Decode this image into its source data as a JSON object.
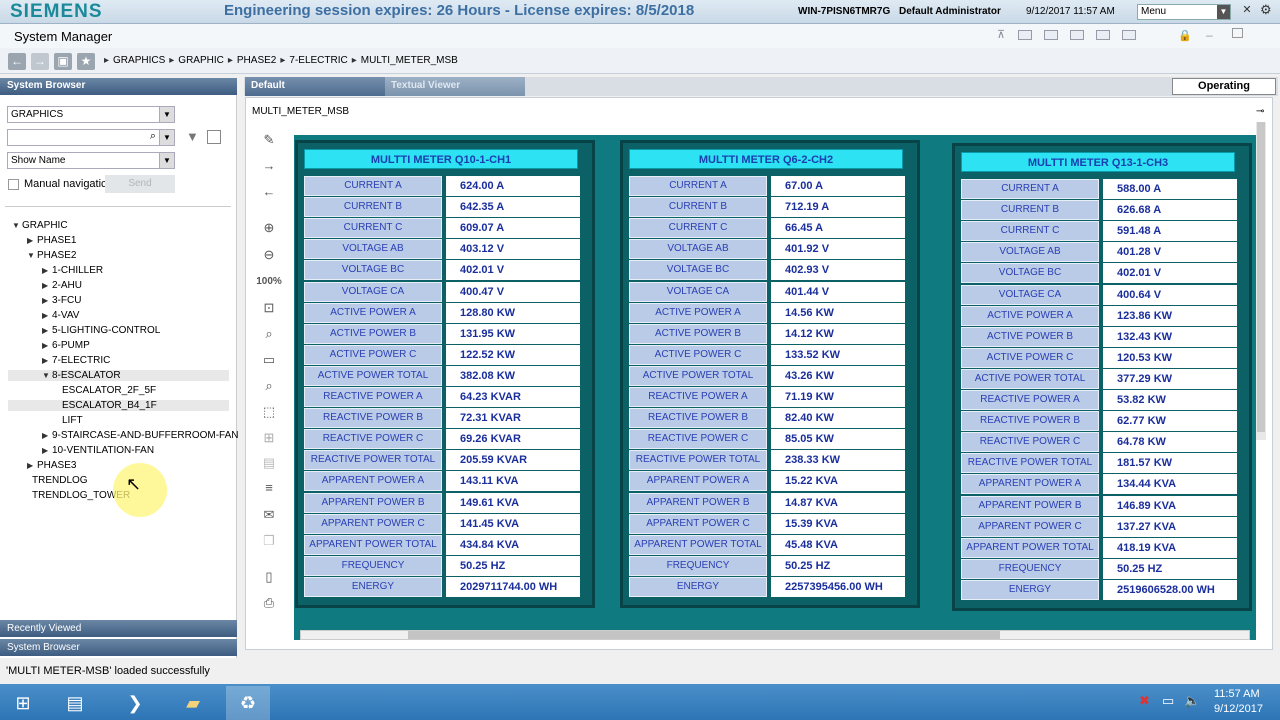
{
  "header": {
    "logo": "SIEMENS",
    "session_text": "Engineering session expires: 26 Hours - License expires: 8/5/2018",
    "hostname": "WIN-7PISN6TMR7G",
    "user": "Default Administrator",
    "datetime": "9/12/2017  11:57 AM",
    "menu_label": "Menu"
  },
  "app_title": "System Manager",
  "breadcrumb": [
    "GRAPHICS",
    "GRAPHIC",
    "PHASE2",
    "7-ELECTRIC",
    "MULTI_METER_MSB"
  ],
  "system_browser": {
    "title": "System Browser",
    "view_select": "GRAPHICS",
    "search_value": "",
    "name_select": "Show Name",
    "manual_navigation": "Manual navigatic",
    "send_label": "Send",
    "tree": [
      {
        "label": "GRAPHIC",
        "level": 0,
        "arrow": "open"
      },
      {
        "label": "PHASE1",
        "level": 1,
        "arrow": "closed"
      },
      {
        "label": "PHASE2",
        "level": 1,
        "arrow": "open"
      },
      {
        "label": "1-CHILLER",
        "level": 2,
        "arrow": "closed"
      },
      {
        "label": "2-AHU",
        "level": 2,
        "arrow": "closed"
      },
      {
        "label": "3-FCU",
        "level": 2,
        "arrow": "closed"
      },
      {
        "label": "4-VAV",
        "level": 2,
        "arrow": "closed"
      },
      {
        "label": "5-LIGHTING-CONTROL",
        "level": 2,
        "arrow": "closed"
      },
      {
        "label": "6-PUMP",
        "level": 2,
        "arrow": "closed"
      },
      {
        "label": "7-ELECTRIC",
        "level": 2,
        "arrow": "closed"
      },
      {
        "label": "8-ESCALATOR",
        "level": 2,
        "arrow": "open",
        "highlight": true
      },
      {
        "label": "ESCALATOR_2F_5F",
        "level": 3,
        "arrow": "none"
      },
      {
        "label": "ESCALATOR_B4_1F",
        "level": 3,
        "arrow": "none",
        "highlight": true
      },
      {
        "label": "LIFT",
        "level": 3,
        "arrow": "none"
      },
      {
        "label": "9-STAIRCASE-AND-BUFFERROOM-FAN",
        "level": 2,
        "arrow": "closed"
      },
      {
        "label": "10-VENTILATION-FAN",
        "level": 2,
        "arrow": "closed"
      },
      {
        "label": "PHASE3",
        "level": 1,
        "arrow": "closed"
      },
      {
        "label": "TRENDLOG",
        "level": 1,
        "arrow": "none"
      },
      {
        "label": "TRENDLOG_TOWER",
        "level": 1,
        "arrow": "none"
      }
    ],
    "recently_viewed": "Recently Viewed",
    "bottom_tab": "System Browser"
  },
  "status_message": "'MULTI METER-MSB' loaded successfully",
  "tabs": {
    "default": "Default",
    "textual": "Textual Viewer",
    "mode": "Operating"
  },
  "zoom": "100%",
  "graphic_title": "MULTI_METER_MSB",
  "row_labels": [
    "CURRENT A",
    "CURRENT B",
    "CURRENT C",
    "VOLTAGE AB",
    "VOLTAGE BC",
    "VOLTAGE CA",
    "ACTIVE POWER A",
    "ACTIVE POWER B",
    "ACTIVE POWER C",
    "ACTIVE POWER TOTAL",
    "REACTIVE POWER A",
    "REACTIVE POWER B",
    "REACTIVE POWER C",
    "REACTIVE POWER TOTAL",
    "APPARENT POWER A",
    "APPARENT POWER B",
    "APPARENT POWER C",
    "APPARENT POWER TOTAL",
    "FREQUENCY",
    "ENERGY"
  ],
  "meters": [
    {
      "title": "MULTTI METER Q10-1-CH1",
      "values": [
        "624.00 A",
        "642.35 A",
        "609.07 A",
        "403.12 V",
        "402.01 V",
        "400.47 V",
        "128.80 KW",
        "131.95 KW",
        "122.52 KW",
        "382.08 KW",
        "64.23 KVAR",
        "72.31 KVAR",
        "69.26 KVAR",
        "205.59 KVAR",
        "143.11 KVA",
        "149.61 KVA",
        "141.45 KVA",
        "434.84 KVA",
        "50.25 HZ",
        "2029711744.00 WH"
      ]
    },
    {
      "title": "MULTTI METER Q6-2-CH2",
      "values": [
        "67.00 A",
        "712.19 A",
        "66.45 A",
        "401.92 V",
        "402.93 V",
        "401.44 V",
        "14.56 KW",
        "14.12 KW",
        "133.52 KW",
        "43.26 KW",
        "71.19 KW",
        "82.40 KW",
        "85.05 KW",
        "238.33 KW",
        "15.22 KVA",
        "14.87 KVA",
        "15.39 KVA",
        "45.48 KVA",
        "50.25 HZ",
        "2257395456.00 WH"
      ]
    },
    {
      "title": "MULTTI METER Q13-1-CH3",
      "values": [
        "588.00 A",
        "626.68 A",
        "591.48 A",
        "401.28 V",
        "402.01 V",
        "400.64 V",
        "123.86 KW",
        "132.43 KW",
        "120.53 KW",
        "377.29 KW",
        "53.82 KW",
        "62.77 KW",
        "64.78 KW",
        "181.57 KW",
        "134.44 KVA",
        "146.89 KVA",
        "137.27 KVA",
        "418.19 KVA",
        "50.25 HZ",
        "2519606528.00 WH"
      ]
    }
  ],
  "taskbar": {
    "time": "11:57 AM",
    "date": "9/12/2017"
  },
  "colors": {
    "canvas": "#0f7a7f",
    "meter_title": "#2de2f2",
    "label_bg": "#b9cbe6",
    "label_text": "#2b3fb5"
  }
}
